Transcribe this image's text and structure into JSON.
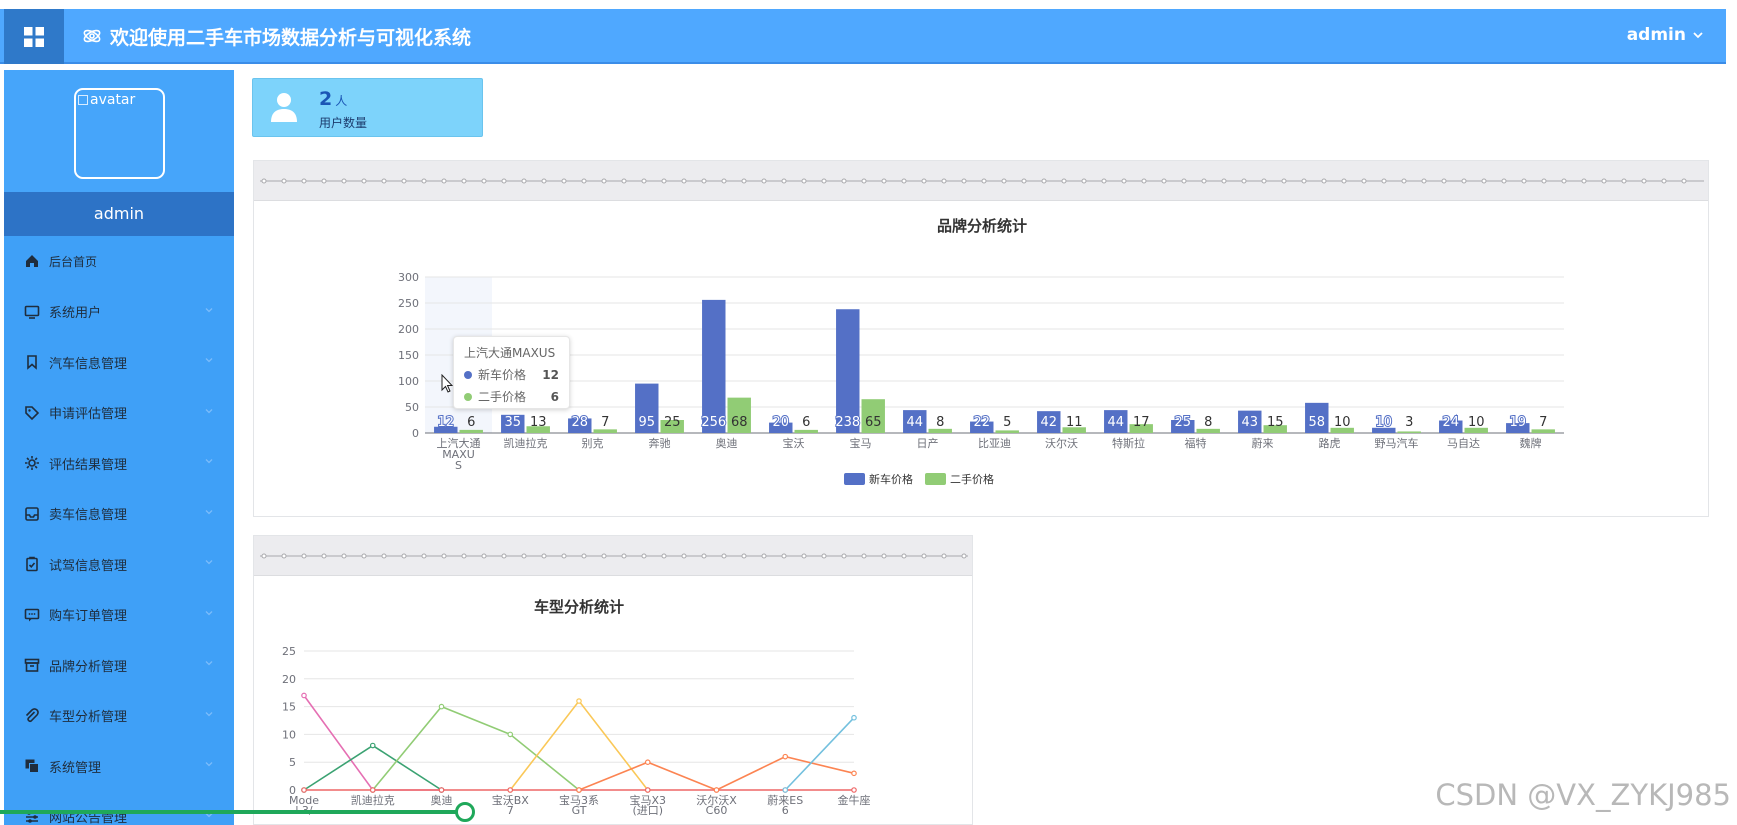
{
  "header": {
    "title": "欢迎使用二手车市场数据分析与可视化系统",
    "user_menu": "admin"
  },
  "sidebar": {
    "avatar_alt": "avatar",
    "username": "admin",
    "items": [
      {
        "label": "后台首页",
        "icon": "home-icon"
      },
      {
        "label": "系统用户",
        "icon": "monitor-icon"
      },
      {
        "label": "汽车信息管理",
        "icon": "bookmark-icon"
      },
      {
        "label": "申请评估管理",
        "icon": "tag-icon"
      },
      {
        "label": "评估结果管理",
        "icon": "gear-icon"
      },
      {
        "label": "卖车信息管理",
        "icon": "inbox-icon"
      },
      {
        "label": "试驾信息管理",
        "icon": "clipboard-icon"
      },
      {
        "label": "购车订单管理",
        "icon": "message-icon"
      },
      {
        "label": "品牌分析管理",
        "icon": "archive-icon"
      },
      {
        "label": "车型分析管理",
        "icon": "paperclip-icon"
      },
      {
        "label": "系统管理",
        "icon": "copy-icon"
      },
      {
        "label": "网站公告管理",
        "icon": "sliders-icon"
      }
    ]
  },
  "stat": {
    "value": "2",
    "unit": "人",
    "label": "用户数量"
  },
  "colors": {
    "series_new": "#5470c6",
    "series_used": "#91cc75"
  },
  "tooltip": {
    "title": "上汽大通MAXUS",
    "rows": [
      {
        "name": "新车价格",
        "value": "12"
      },
      {
        "name": "二手价格",
        "value": "6"
      }
    ]
  },
  "chart_data": [
    {
      "type": "bar",
      "title": "品牌分析统计",
      "categories": [
        "上汽大通MAXUS",
        "凯迪拉克",
        "别克",
        "奔驰",
        "奥迪",
        "宝沃",
        "宝马",
        "日产",
        "比亚迪",
        "沃尔沃",
        "特斯拉",
        "福特",
        "蔚来",
        "路虎",
        "野马汽车",
        "马自达",
        "魏牌"
      ],
      "category_labels": [
        "上汽大通\nMAXU\nS",
        "凯迪拉克",
        "别克",
        "奔驰",
        "奥迪",
        "宝沃",
        "宝马",
        "日产",
        "比亚迪",
        "沃尔沃",
        "特斯拉",
        "福特",
        "蔚来",
        "路虎",
        "野马汽车",
        "马自达",
        "魏牌"
      ],
      "series": [
        {
          "name": "新车价格",
          "values": [
            12,
            35,
            28,
            95,
            256,
            20,
            238,
            44,
            22,
            42,
            44,
            25,
            43,
            58,
            10,
            24,
            19
          ]
        },
        {
          "name": "二手价格",
          "values": [
            6,
            13,
            7,
            25,
            68,
            6,
            65,
            8,
            5,
            11,
            17,
            8,
            15,
            10,
            3,
            10,
            7
          ]
        }
      ],
      "yticks": [
        0,
        50,
        100,
        150,
        200,
        250,
        300
      ],
      "ylim": [
        0,
        300
      ],
      "legend": "bottom-center",
      "grid": true
    },
    {
      "type": "line",
      "title": "车型分析统计",
      "categories": [
        "Mode\nl 3/",
        "凯迪拉克",
        "奥迪",
        "宝沃BX\n7",
        "宝马3系\nGT",
        "宝马X3\n(进口)",
        "沃尔沃X\nC60",
        "蔚来ES\n6",
        "金牛座"
      ],
      "yticks": [
        0,
        5,
        10,
        15,
        20,
        25
      ],
      "ylim": [
        0,
        25
      ],
      "grid": true,
      "series": [
        {
          "color": "#e56fb3",
          "points": [
            [
              0,
              17
            ],
            [
              1,
              0
            ],
            [
              2,
              0
            ]
          ]
        },
        {
          "color": "#3ba272",
          "points": [
            [
              0,
              0
            ],
            [
              1,
              8
            ],
            [
              2,
              0
            ]
          ]
        },
        {
          "color": "#91cc75",
          "points": [
            [
              1,
              0
            ],
            [
              2,
              15
            ],
            [
              3,
              10
            ],
            [
              4,
              0
            ]
          ]
        },
        {
          "color": "#fac858",
          "points": [
            [
              3,
              0
            ],
            [
              4,
              16
            ],
            [
              5,
              0
            ]
          ]
        },
        {
          "color": "#ee6666",
          "points": [
            [
              0,
              0
            ],
            [
              1,
              0
            ],
            [
              2,
              0
            ],
            [
              3,
              0
            ],
            [
              4,
              0
            ],
            [
              5,
              0
            ],
            [
              6,
              0
            ],
            [
              7,
              0
            ],
            [
              8,
              0
            ]
          ]
        },
        {
          "color": "#fc8452",
          "points": [
            [
              4,
              0
            ],
            [
              5,
              5
            ],
            [
              6,
              0
            ],
            [
              7,
              6
            ],
            [
              8,
              3
            ]
          ]
        },
        {
          "color": "#73c0de",
          "points": [
            [
              7,
              0
            ],
            [
              8,
              13
            ]
          ]
        }
      ]
    }
  ],
  "watermark": "CSDN @VX_ZYKJ985"
}
